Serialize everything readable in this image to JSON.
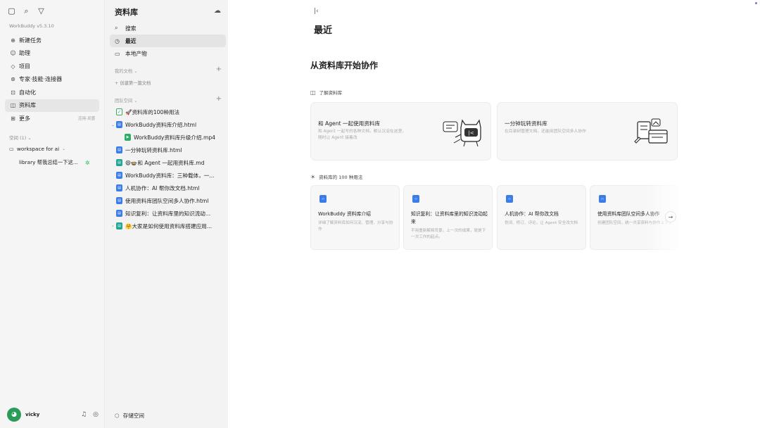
{
  "sidebar": {
    "app_version": "WorkBuddy v5.3.10",
    "nav": [
      {
        "label": "新建任务",
        "icon": "⊕"
      },
      {
        "label": "助理",
        "icon": "☺"
      },
      {
        "label": "项目",
        "icon": "◇"
      },
      {
        "label": "专家·技能·连接器",
        "icon": "⊛"
      },
      {
        "label": "自动化",
        "icon": "⊡"
      },
      {
        "label": "资料库",
        "icon": "◫"
      },
      {
        "label": "更多",
        "icon": "⊞",
        "hint": "应用·灵感"
      }
    ],
    "space_label": "空间 (1)",
    "workspace": "workspace for ai",
    "library_item": "library 帮我总结一下这...",
    "username": "vicky"
  },
  "panel": {
    "title": "资料库",
    "nav": [
      {
        "label": "搜索",
        "icon": "⌕"
      },
      {
        "label": "最近",
        "icon": "◷"
      },
      {
        "label": "本地产物",
        "icon": "▭"
      }
    ],
    "my_docs_label": "我的文档",
    "create_doc": "+ 创建第一篇文档",
    "team_label": "团队空间",
    "tree": [
      {
        "label": "🚀资料库的100种用法",
        "chev": "",
        "icon": "check",
        "indent": 0
      },
      {
        "label": "WorkBuddy资料库介绍.html",
        "chev": "⌄",
        "icon": "blue",
        "indent": 0
      },
      {
        "label": "WorkBuddy资料库升级介绍.mp4",
        "chev": "",
        "icon": "green",
        "indent": 1
      },
      {
        "label": "一分钟玩转资料库.html",
        "chev": "",
        "icon": "blue",
        "indent": 0
      },
      {
        "label": "😄🍲和 Agent 一起用资料库.md",
        "chev": "",
        "icon": "teal",
        "indent": 0
      },
      {
        "label": "WorkBuddy资料库：三种载体，一...",
        "chev": "",
        "icon": "blue",
        "indent": 0
      },
      {
        "label": "人机协作：AI 帮你改文档.html",
        "chev": "",
        "icon": "blue",
        "indent": 0
      },
      {
        "label": "使用资料库团队空间多人协作.html",
        "chev": "",
        "icon": "blue",
        "indent": 0
      },
      {
        "label": "知识复利：让资料库里的知识流动...",
        "chev": "",
        "icon": "blue",
        "indent": 0
      },
      {
        "label": "🤗大家是如何使用资料库搭建应用...",
        "chev": "›",
        "icon": "teal",
        "indent": 0
      }
    ],
    "storage": "存储空间"
  },
  "main": {
    "page_title": "最近",
    "hero_title": "从资料库开始协作",
    "section1": "了解资料库",
    "big_cards": [
      {
        "title": "和 Agent 一起使用资料库",
        "desc": "和 Agent 一起写的各种文档，默认沉淀在这里，随时让 Agent 接着改"
      },
      {
        "title": "一分钟玩转资料库",
        "desc": "在目录树管理文档，还能用团队空间多人协作"
      }
    ],
    "section2": "资料库的 100 种用法",
    "small_cards": [
      {
        "title": "WorkBuddy 资料库介绍",
        "desc": "详细了解资料库如何沉淀、管理、分享与协作"
      },
      {
        "title": "知识复利：让资料库里的知识流动起来",
        "desc": "不用重新解释背景，上一次的成果，就是下一次工作的起点。"
      },
      {
        "title": "人机协作：AI 帮你改文档",
        "desc": "划词、修订、评论，让 Agent 安全改文档"
      },
      {
        "title": "使用资料库团队空间多人协作",
        "desc": "创建团队空间，统一共享资料与协作上下文"
      }
    ]
  }
}
